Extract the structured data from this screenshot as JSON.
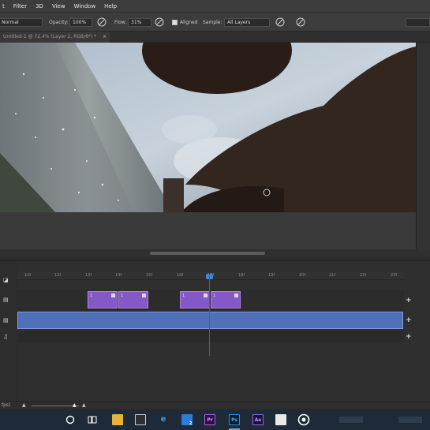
{
  "menubar": {
    "items": [
      "t",
      "Filter",
      "3D",
      "View",
      "Window",
      "Help"
    ]
  },
  "options": {
    "mode_value": "Normal",
    "opacity_label": "Opacity:",
    "opacity_value": "100%",
    "flow_label": "Flow:",
    "flow_value": "31%",
    "aligned_label": "Aligned",
    "sample_label": "Sample:",
    "sample_value": "All Layers"
  },
  "document_tab": {
    "title": "Untitled-1 @ 72.4% (Layer 2, RGB/8*) *"
  },
  "timeline": {
    "ruler_ticks": [
      "10f",
      "12f",
      "13f",
      "14f",
      "15f",
      "16f",
      "17f",
      "18f",
      "19f",
      "20f",
      "21f",
      "22f",
      "23f"
    ],
    "clip_label": "1",
    "fps_label": "fps)"
  },
  "colors": {
    "clip": "#8458c6",
    "video_track": "#4f6fb7",
    "playhead": "#d03030",
    "playhead_handle": "#3e86d8"
  },
  "taskbar": {
    "icons": [
      "cortana-icon",
      "task-view-icon",
      "file-explorer-icon",
      "store-icon",
      "edge-icon",
      "mail-icon",
      "premiere-icon",
      "photoshop-icon",
      "after-effects-icon",
      "photos-icon",
      "app-icon"
    ],
    "premiere_label": "Pr",
    "photoshop_label": "Ps",
    "after_effects_label": "Ae",
    "badge_count": "2"
  }
}
